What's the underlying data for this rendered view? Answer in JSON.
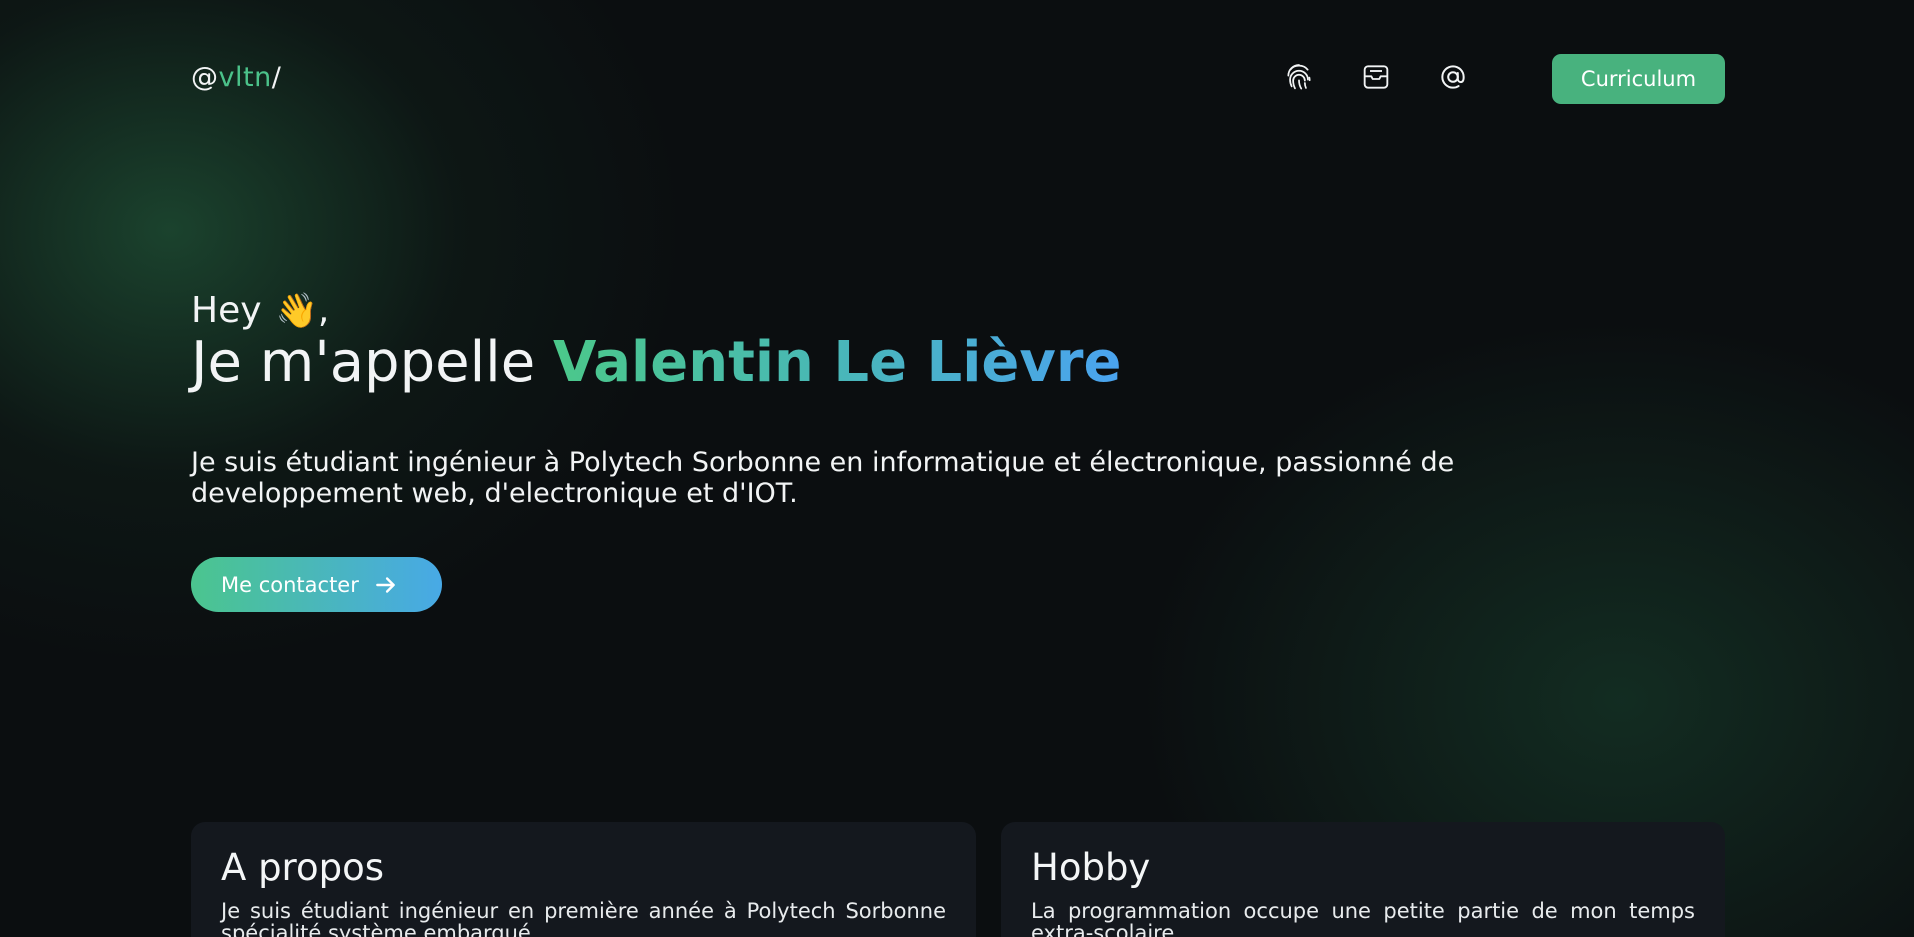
{
  "header": {
    "logo_prefix": "@",
    "logo_accent": "vltn",
    "logo_suffix": "/",
    "icons": [
      "fingerprint-icon",
      "inbox-icon",
      "at-icon"
    ],
    "cv_label": "Curriculum"
  },
  "hero": {
    "greeting": "Hey",
    "greeting_emoji": "👋",
    "greeting_suffix": ",",
    "headline_prefix": "Je m'appelle ",
    "name": "Valentin Le Lièvre",
    "intro": "Je suis étudiant ingénieur à Polytech Sorbonne en informatique et électronique, passionné de developpement web, d'electronique et d'IOT.",
    "contact_label": "Me contacter"
  },
  "cards": {
    "about": {
      "title": "A propos",
      "text": "Je suis étudiant ingénieur en première année à Polytech Sorbonne spécialité système embarqué."
    },
    "hobby": {
      "title": "Hobby",
      "text": "La programmation occupe une petite partie de mon temps extra-scolaire."
    }
  },
  "colors": {
    "accent_green": "#48b27e",
    "gradient_start": "#4bc58e",
    "gradient_end": "#48a9e6",
    "background": "#0b0e10",
    "card_background": "#14181e"
  }
}
